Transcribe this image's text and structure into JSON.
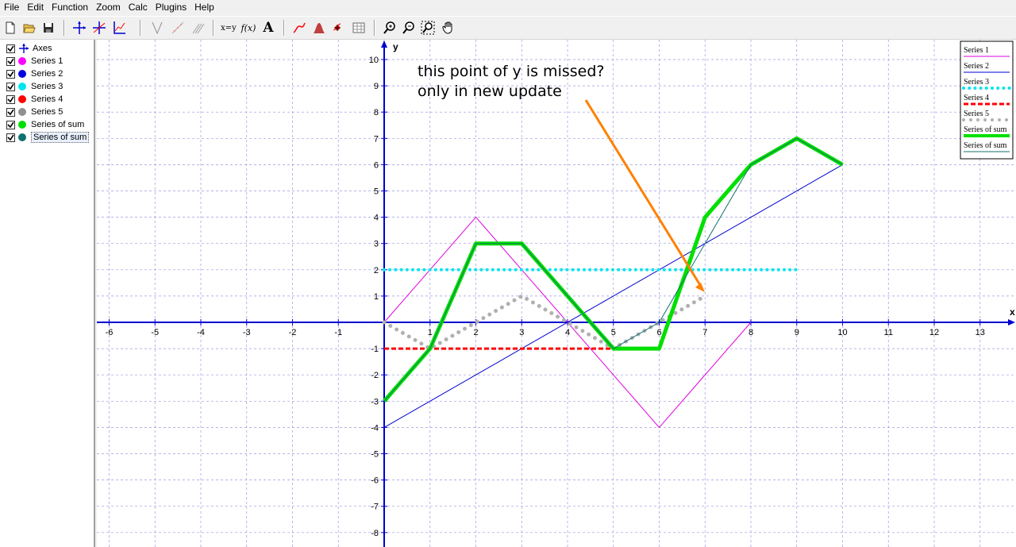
{
  "menu": [
    "File",
    "Edit",
    "Function",
    "Zoom",
    "Calc",
    "Plugins",
    "Help"
  ],
  "toolbar": {
    "xy_label": "x=y",
    "fx_label": "f(x)",
    "text_label": "A"
  },
  "series_list": [
    {
      "label": "Axes",
      "checked": true,
      "icon": "axes-icon"
    },
    {
      "label": "Series 1",
      "checked": true,
      "color": "#ff00ff"
    },
    {
      "label": "Series 2",
      "checked": true,
      "color": "#0000e0"
    },
    {
      "label": "Series 3",
      "checked": true,
      "color": "#00e5ee"
    },
    {
      "label": "Series 4",
      "checked": true,
      "color": "#ff0000"
    },
    {
      "label": "Series 5",
      "checked": true,
      "color": "#909090"
    },
    {
      "label": "Series of sum",
      "checked": true,
      "color": "#00e000"
    },
    {
      "label": "Series of sum",
      "checked": true,
      "color": "#107070",
      "selected": true
    }
  ],
  "annotation": {
    "line1": "this point of y is missed?",
    "line2": "only in new update",
    "arrow_color": "#ff8000"
  },
  "chart_data": {
    "type": "line",
    "xlabel": "x",
    "ylabel": "y",
    "xlim": [
      -6.3,
      13.7
    ],
    "ylim": [
      -8.5,
      10.6
    ],
    "x_ticks": [
      -6,
      -5,
      -4,
      -3,
      -2,
      -1,
      1,
      2,
      3,
      4,
      5,
      6,
      7,
      8,
      9,
      10,
      11,
      12,
      13
    ],
    "y_ticks": [
      -8,
      -7,
      -6,
      -5,
      -4,
      -3,
      -2,
      -1,
      1,
      2,
      3,
      4,
      5,
      6,
      7,
      8,
      9,
      10
    ],
    "grid": true,
    "legend": "top-right",
    "series": [
      {
        "name": "Series 1",
        "color": "#e000e0",
        "style": "solid",
        "width": 1,
        "points": [
          [
            0,
            0
          ],
          [
            2,
            4
          ],
          [
            6,
            -4
          ],
          [
            8,
            0
          ]
        ]
      },
      {
        "name": "Series 2",
        "color": "#0000d0",
        "style": "solid",
        "width": 1,
        "points": [
          [
            0,
            -4
          ],
          [
            10,
            6
          ]
        ]
      },
      {
        "name": "Series 3",
        "color": "#00e5ee",
        "style": "dotted",
        "width": 4,
        "points": [
          [
            0,
            2
          ],
          [
            9,
            2
          ]
        ]
      },
      {
        "name": "Series 4",
        "color": "#ff0000",
        "style": "dashed",
        "width": 3,
        "points": [
          [
            0,
            -1
          ],
          [
            5,
            -1
          ]
        ]
      },
      {
        "name": "Series 5",
        "color": "#b0b0b0",
        "style": "dotted",
        "width": 5,
        "points": [
          [
            0,
            0
          ],
          [
            1,
            -1
          ],
          [
            2,
            0
          ],
          [
            3,
            1
          ],
          [
            4,
            0
          ],
          [
            5,
            -1
          ],
          [
            6,
            0
          ],
          [
            7,
            1
          ]
        ]
      },
      {
        "name": "Series of sum",
        "color": "#00e000",
        "style": "solid",
        "width": 5,
        "points": [
          [
            0,
            -3
          ],
          [
            1,
            -1
          ],
          [
            2,
            3
          ],
          [
            3,
            3
          ],
          [
            4,
            1
          ],
          [
            5,
            -1
          ],
          [
            6,
            -1
          ],
          [
            7,
            4
          ],
          [
            8,
            6
          ],
          [
            9,
            7
          ],
          [
            10,
            6
          ]
        ]
      },
      {
        "name": "Series of sum",
        "color": "#107070",
        "style": "solid",
        "width": 1,
        "points": [
          [
            0,
            -3
          ],
          [
            1,
            -1
          ],
          [
            2,
            3
          ],
          [
            3,
            3
          ],
          [
            4,
            1
          ],
          [
            5,
            -1
          ],
          [
            6,
            0
          ],
          [
            8,
            6
          ],
          [
            9,
            7
          ],
          [
            10,
            6
          ]
        ]
      }
    ]
  }
}
